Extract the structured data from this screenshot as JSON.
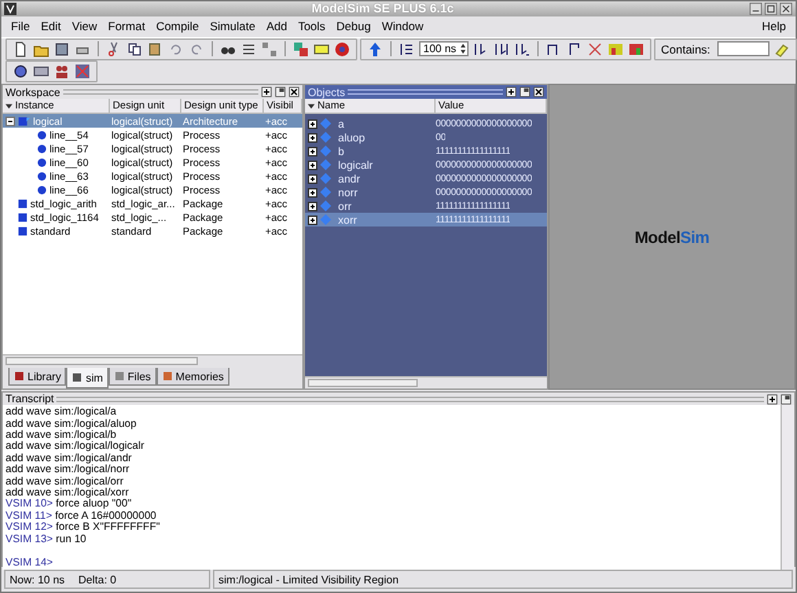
{
  "window": {
    "title": "ModelSim SE PLUS 6.1c"
  },
  "menu": {
    "items": [
      "File",
      "Edit",
      "View",
      "Format",
      "Compile",
      "Simulate",
      "Add",
      "Tools",
      "Debug",
      "Window"
    ],
    "help": "Help"
  },
  "toolbar": {
    "run_length": "100 ns",
    "contains_label": "Contains:"
  },
  "workspace": {
    "title": "Workspace",
    "columns": [
      "Instance",
      "Design unit",
      "Design unit type",
      "Visibil"
    ],
    "tree": [
      {
        "kind": "architecture",
        "name": "logical",
        "unit": "logical(struct)",
        "type": "Architecture",
        "visibility": "+acc",
        "selected": true,
        "expanded": true,
        "children": [
          {
            "kind": "process",
            "name": "line__54",
            "unit": "logical(struct)",
            "type": "Process",
            "visibility": "+acc",
            "selected": false
          },
          {
            "kind": "process",
            "name": "line__57",
            "unit": "logical(struct)",
            "type": "Process",
            "visibility": "+acc",
            "selected": false
          },
          {
            "kind": "process",
            "name": "line__60",
            "unit": "logical(struct)",
            "type": "Process",
            "visibility": "+acc",
            "selected": false
          },
          {
            "kind": "process",
            "name": "line__63",
            "unit": "logical(struct)",
            "type": "Process",
            "visibility": "+acc",
            "selected": false
          },
          {
            "kind": "process",
            "name": "line__66",
            "unit": "logical(struct)",
            "type": "Process",
            "visibility": "+acc",
            "selected": false
          }
        ]
      },
      {
        "kind": "package",
        "name": "std_logic_arith",
        "unit": "std_logic_ar...",
        "type": "Package",
        "visibility": "+acc",
        "selected": false
      },
      {
        "kind": "package",
        "name": "std_logic_1164",
        "unit": "std_logic_...",
        "type": "Package",
        "visibility": "+acc",
        "selected": false
      },
      {
        "kind": "package",
        "name": "standard",
        "unit": "standard",
        "type": "Package",
        "visibility": "+acc",
        "selected": false
      }
    ],
    "tabs": [
      {
        "label": "Library",
        "selected": false
      },
      {
        "label": "sim",
        "selected": true
      },
      {
        "label": "Files",
        "selected": false
      },
      {
        "label": "Memories",
        "selected": false
      }
    ]
  },
  "objects": {
    "title": "Objects",
    "columns": [
      "Name",
      "Value"
    ],
    "rows": [
      {
        "name": "a",
        "value": "0000000000000000000",
        "selected": false,
        "expanded": false
      },
      {
        "name": "aluop",
        "value": "00",
        "selected": false,
        "expanded": false
      },
      {
        "name": "b",
        "value": "11111111111111111",
        "selected": false,
        "expanded": false
      },
      {
        "name": "logicalr",
        "value": "0000000000000000000",
        "selected": false,
        "expanded": false
      },
      {
        "name": "andr",
        "value": "0000000000000000000",
        "selected": false,
        "expanded": false
      },
      {
        "name": "norr",
        "value": "0000000000000000000",
        "selected": false,
        "expanded": false
      },
      {
        "name": "orr",
        "value": "11111111111111111",
        "selected": false,
        "expanded": false
      },
      {
        "name": "xorr",
        "value": "11111111111111111",
        "selected": true,
        "expanded": false
      }
    ]
  },
  "logo": [
    "Model",
    "Sim"
  ],
  "transcript": {
    "title": "Transcript",
    "lines": [
      {
        "kind": "output",
        "text": "add wave sim:/logical/a"
      },
      {
        "kind": "output",
        "text": "add wave sim:/logical/aluop"
      },
      {
        "kind": "output",
        "text": "add wave sim:/logical/b"
      },
      {
        "kind": "output",
        "text": "add wave sim:/logical/logicalr"
      },
      {
        "kind": "output",
        "text": "add wave sim:/logical/andr"
      },
      {
        "kind": "output",
        "text": "add wave sim:/logical/norr"
      },
      {
        "kind": "output",
        "text": "add wave sim:/logical/orr"
      },
      {
        "kind": "output",
        "text": "add wave sim:/logical/xorr"
      },
      {
        "kind": "command",
        "prompt": "VSIM 10>",
        "text": "force aluop \"00\""
      },
      {
        "kind": "command",
        "prompt": "VSIM 11>",
        "text": "force A 16#00000000"
      },
      {
        "kind": "command",
        "prompt": "VSIM 12>",
        "text": "force B X\"FFFFFFFF\""
      },
      {
        "kind": "command",
        "prompt": "VSIM 13>",
        "text": "run 10"
      },
      {
        "kind": "prompt",
        "prompt": "VSIM 14>"
      }
    ]
  },
  "status_bar": {
    "now": "Now: 10 ns",
    "delta": "Delta: 0",
    "context": "sim:/logical - Limited Visibility Region"
  }
}
